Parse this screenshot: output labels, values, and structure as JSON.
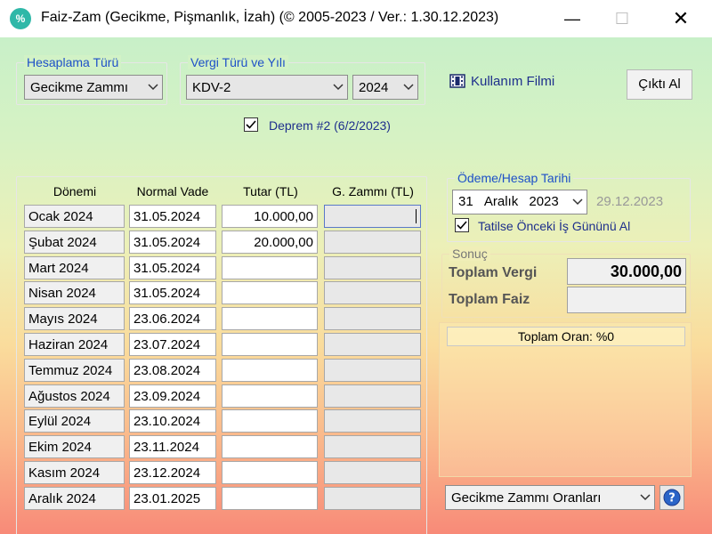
{
  "window": {
    "icon_glyph": "%",
    "title": "Faiz-Zam (Gecikme, Pişmanlık, İzah) (©  2005-2023 / Ver.: 1.30.12.2023)",
    "minimize_glyph": "—",
    "maximize_glyph": "☐",
    "close_glyph": "✕"
  },
  "hesaplama": {
    "legend": "Hesaplama Türü",
    "selected": "Gecikme Zammı"
  },
  "vergi": {
    "legend": "Vergi Türü ve Yılı",
    "type_selected": "KDV-2",
    "year_selected": "2024"
  },
  "deprem": {
    "label": "Deprem #2 (6/2/2023)",
    "checked": true
  },
  "kullanim_filmi": "Kullanım Filmi",
  "cikti_al": "Çıktı Al",
  "table": {
    "headers": [
      "Dönemi",
      "Normal Vade",
      "Tutar (TL)",
      "G. Zammı (TL)"
    ],
    "rows": [
      {
        "donem": "Ocak 2024",
        "vade": "31.05.2024",
        "tutar": "10.000,00",
        "zam": ""
      },
      {
        "donem": "Şubat 2024",
        "vade": "31.05.2024",
        "tutar": "20.000,00",
        "zam": ""
      },
      {
        "donem": "Mart 2024",
        "vade": "31.05.2024",
        "tutar": "",
        "zam": ""
      },
      {
        "donem": "Nisan 2024",
        "vade": "31.05.2024",
        "tutar": "",
        "zam": ""
      },
      {
        "donem": "Mayıs 2024",
        "vade": "23.06.2024",
        "tutar": "",
        "zam": ""
      },
      {
        "donem": "Haziran 2024",
        "vade": "23.07.2024",
        "tutar": "",
        "zam": ""
      },
      {
        "donem": "Temmuz 2024",
        "vade": "23.08.2024",
        "tutar": "",
        "zam": ""
      },
      {
        "donem": "Ağustos 2024",
        "vade": "23.09.2024",
        "tutar": "",
        "zam": ""
      },
      {
        "donem": "Eylül 2024",
        "vade": "23.10.2024",
        "tutar": "",
        "zam": ""
      },
      {
        "donem": "Ekim 2024",
        "vade": "23.11.2024",
        "tutar": "",
        "zam": ""
      },
      {
        "donem": "Kasım 2024",
        "vade": "23.12.2024",
        "tutar": "",
        "zam": ""
      },
      {
        "donem": "Aralık 2024",
        "vade": "23.01.2025",
        "tutar": "",
        "zam": ""
      }
    ]
  },
  "odeme": {
    "legend": "Ödeme/Hesap Tarihi",
    "day": "31",
    "month": "Aralık",
    "year": "2023",
    "ref_date": "29.12.2023",
    "tatil_label": "Tatilse Önceki İş Gününü Al",
    "tatil_checked": true
  },
  "sonuc": {
    "legend": "Sonuç",
    "toplam_vergi_label": "Toplam Vergi",
    "toplam_vergi_value": "30.000,00",
    "toplam_faiz_label": "Toplam Faiz",
    "toplam_faiz_value": ""
  },
  "toplam_oran": "Toplam Oran: %0",
  "oranlar_select": "Gecikme Zammı Oranları",
  "colors": {
    "legend_blue": "#1e50c8",
    "label_navy": "#1e2f8c",
    "help_blue": "#2a64c8"
  }
}
